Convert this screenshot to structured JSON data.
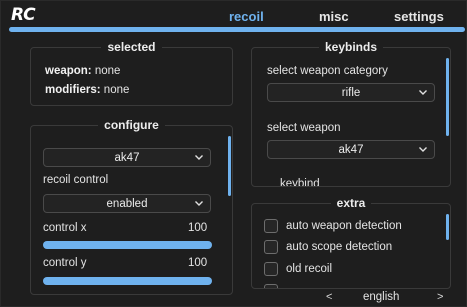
{
  "header": {
    "logo": "RC",
    "tabs": [
      {
        "label": "recoil",
        "active": true
      },
      {
        "label": "misc",
        "active": false
      },
      {
        "label": "settings",
        "active": false
      }
    ]
  },
  "colors": {
    "accent": "#6fb2ee",
    "background": "#1e1e1e",
    "border": "#3a3a3a"
  },
  "selected": {
    "title": "selected",
    "weapon_label": "weapon:",
    "weapon_value": "none",
    "modifiers_label": "modifiers:",
    "modifiers_value": "none"
  },
  "configure": {
    "title": "configure",
    "weapon_dropdown": "ak47",
    "recoil_control_label": "recoil control",
    "recoil_control_dropdown": "enabled",
    "control_x_label": "control x",
    "control_x_value": "100",
    "control_x_fill": 1.0,
    "control_y_label": "control y",
    "control_y_value": "100",
    "control_y_fill": 1.0
  },
  "keybinds": {
    "title": "keybinds",
    "category_label": "select weapon category",
    "category_dropdown": "rifle",
    "weapon_label": "select weapon",
    "weapon_dropdown": "ak47",
    "partial_label": "keybind"
  },
  "extra": {
    "title": "extra",
    "options": [
      {
        "label": "auto weapon detection",
        "checked": false
      },
      {
        "label": "auto scope detection",
        "checked": false
      },
      {
        "label": "old recoil",
        "checked": false
      }
    ]
  },
  "footer": {
    "prev": "<",
    "language": "english",
    "next": ">"
  },
  "icons": [
    "chevron-down-icon",
    "checkbox-icon"
  ]
}
